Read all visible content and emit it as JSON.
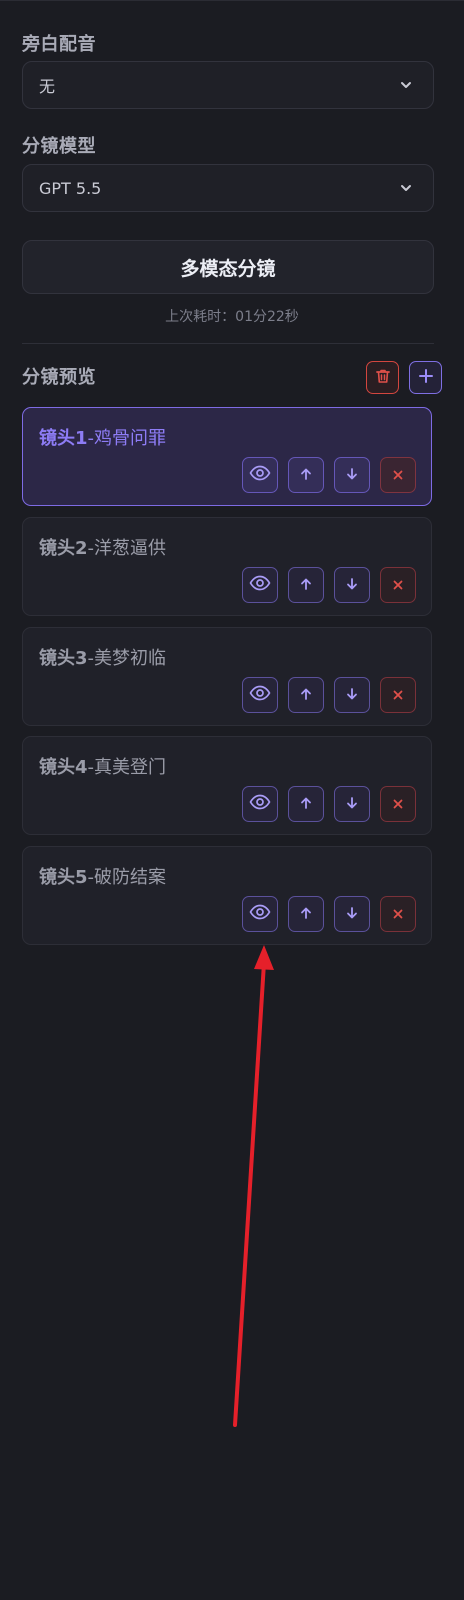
{
  "narration": {
    "label": "旁白配音",
    "value": "无"
  },
  "model": {
    "label": "分镜模型",
    "value": "GPT 5.5"
  },
  "multimodal_button": "多模态分镜",
  "elapsed": "上次耗时：01分22秒",
  "preview": {
    "label": "分镜预览",
    "shots": [
      {
        "num": "镜头1",
        "name": "-鸡骨问罪",
        "active": true
      },
      {
        "num": "镜头2",
        "name": "-洋葱逼供",
        "active": false
      },
      {
        "num": "镜头3",
        "name": "-美梦初临",
        "active": false
      },
      {
        "num": "镜头4",
        "name": "-真美登门",
        "active": false
      },
      {
        "num": "镜头5",
        "name": "-破防结案",
        "active": false
      }
    ]
  },
  "colors": {
    "accent": "#8d7cf5",
    "danger": "#d3463f",
    "annotation_arrow": "#e5202a"
  },
  "icons": [
    "chevron-down-icon",
    "trash-icon",
    "plus-icon",
    "eye-icon",
    "arrow-up-icon",
    "arrow-down-icon",
    "close-icon"
  ]
}
